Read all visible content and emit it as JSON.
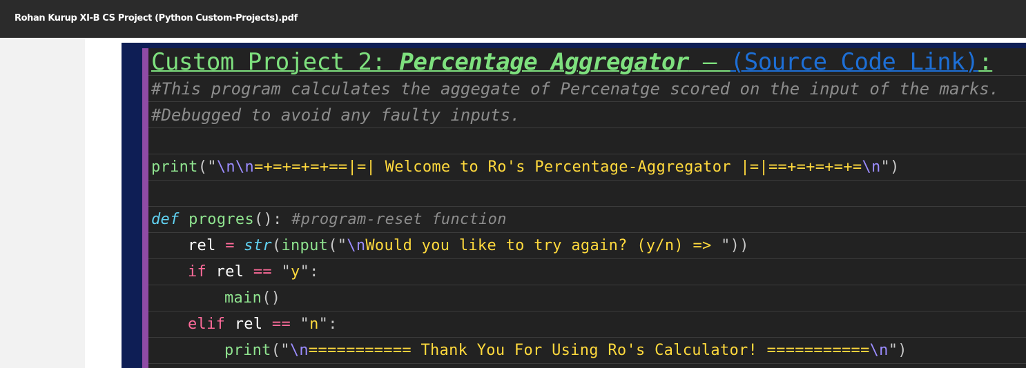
{
  "viewer": {
    "document_title": "Rohan Kurup XI-B CS Project (Python Custom-Projects).pdf"
  },
  "heading": {
    "prefix": "Custom Project 2: ",
    "name": "Percentage Aggregator",
    "dash": " – ",
    "link_text": "(Source Code Link)",
    "colon": ":"
  },
  "comments": {
    "line1": "#This program calculates the aggegate of Percenatge scored on the input of the marks.",
    "line2": "#Debugged to avoid any faulty inputs."
  },
  "code": {
    "l1_fn": "print",
    "l1_open": "(\"",
    "l1_esc1": "\\n\\n",
    "l1_str": "=+=+=+=+==|=| Welcome to Ro's Percentage-Aggregator |=|==+=+=+=+=",
    "l1_esc2": "\\n",
    "l1_close": "\")",
    "l2_kw": "def",
    "l2_name": " progres",
    "l2_paren": "(): ",
    "l2_comment": "#program-reset function",
    "l3_var": "rel ",
    "l3_eq": "=",
    "l3_sp": " ",
    "l3_kw": "str",
    "l3_open": "(",
    "l3_fn": "input",
    "l3_q": "(\"",
    "l3_esc": "\\n",
    "l3_str": "Would you like to try again? (y/n) => ",
    "l3_close": "\"))",
    "l4_kw": "if",
    "l4_var": " rel ",
    "l4_op": "==",
    "l4_q1": " \"",
    "l4_str": "y",
    "l4_q2": "\":",
    "l5_fn": "main",
    "l5_paren": "()",
    "l6_kw": "elif",
    "l6_var": " rel ",
    "l6_op": "==",
    "l6_q1": " \"",
    "l6_str": "n",
    "l6_q2": "\":",
    "l7_fn": "print",
    "l7_open": "(\"",
    "l7_esc1": "\\n",
    "l7_str": "=========== Thank You For Using Ro's Calculator! ===========",
    "l7_esc2": "\\n",
    "l7_close": "\")"
  }
}
